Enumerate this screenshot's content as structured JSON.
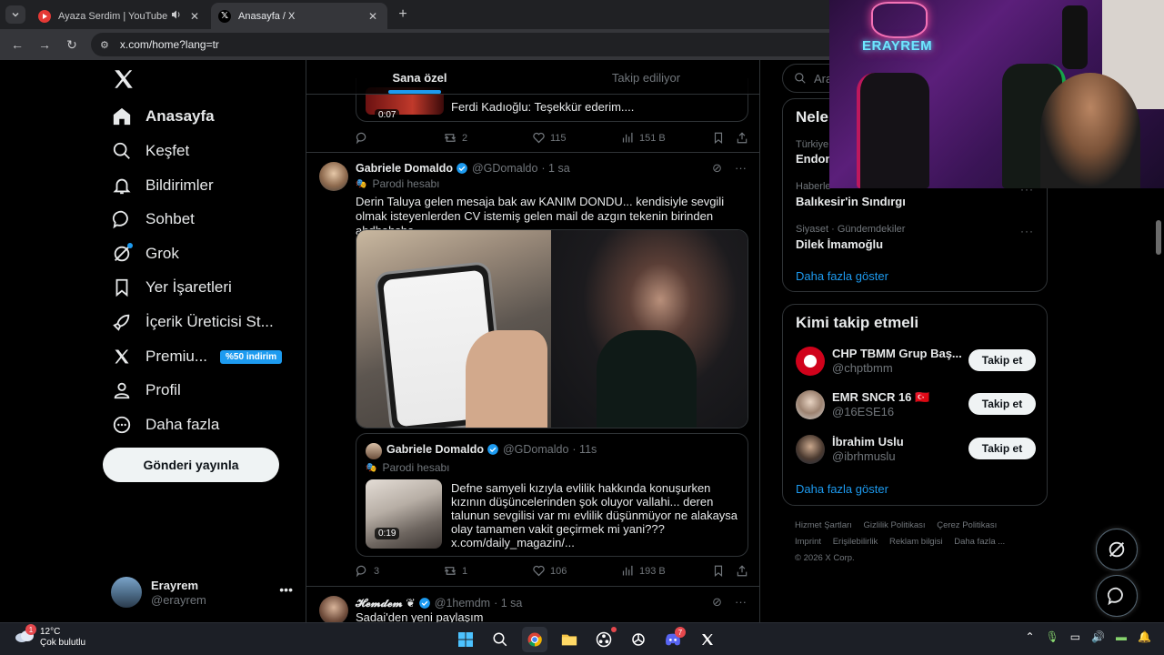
{
  "browser": {
    "tabs": [
      {
        "title": "Ayaza Serdim | YouTube Mu",
        "active": false
      },
      {
        "title": "Anasayfa / X",
        "active": true
      }
    ],
    "url": "x.com/home?lang=tr"
  },
  "webcam": {
    "logo_text": "ERAYREM"
  },
  "nav": {
    "items": [
      {
        "label": "Anasayfa",
        "icon": "home-icon"
      },
      {
        "label": "Keşfet",
        "icon": "search-icon"
      },
      {
        "label": "Bildirimler",
        "icon": "bell-icon"
      },
      {
        "label": "Sohbet",
        "icon": "chat-icon"
      },
      {
        "label": "Grok",
        "icon": "grok-icon"
      },
      {
        "label": "Yer İşaretleri",
        "icon": "bookmark-icon"
      },
      {
        "label": "İçerik Üreticisi St...",
        "icon": "rocket-icon"
      },
      {
        "label": "Premiu...",
        "icon": "x-premium-icon"
      },
      {
        "label": "Profil",
        "icon": "person-icon"
      },
      {
        "label": "Daha fazla",
        "icon": "more-circle-icon"
      }
    ],
    "premium_badge": "%50 indirim",
    "post_button": "Gönderi yayınla",
    "account": {
      "name": "Erayrem",
      "handle": "@erayrem"
    }
  },
  "feed": {
    "tabs": [
      "Sana özel",
      "Takip ediliyor"
    ],
    "prev_tweet": {
      "duration": "0:07",
      "quote_text": "Ferdi Kadıoğlu: Teşekkür ederim....",
      "stats": {
        "reply": "",
        "retweet": "2",
        "like": "115",
        "views": "151 B"
      }
    },
    "tweet": {
      "name": "Gabriele Domaldo",
      "handle": "@GDomaldo",
      "time": "· 1 sa",
      "parody": "Parodi hesabı",
      "text": "Derin Taluya gelen mesaja bak aw KANIM DONDU... kendisiyle sevgili olmak isteyenlerden CV istemiş gelen mail de azgın tekenin birinden ahdhahsha",
      "quote": {
        "name": "Gabriele Domaldo",
        "handle": "@GDomaldo",
        "time": "· 11s",
        "parody": "Parodi hesabı",
        "duration": "0:19",
        "text": "Defne samyeli kızıyla evlilik hakkında konuşurken kızının düşüncelerinden şok oluyor vallahi... deren talunun sevgilisi var mı evlilik düşünmüyor ne alakaysa olay tamamen vakit geçirmek mi yani??? x.com/daily_magazin/..."
      },
      "stats": {
        "reply": "3",
        "retweet": "1",
        "like": "106",
        "views": "193 B"
      }
    },
    "next_tweet": {
      "name": "𝓗𝓮𝓶𝓭𝓮𝓶 ❦",
      "handle": "@1hemdm",
      "time": "· 1 sa",
      "text": "Sadai'den yeni paylaşım"
    }
  },
  "sidebar": {
    "search_placeholder": "Ara",
    "trends_title": "Nele",
    "trends": [
      {
        "context": "Türkiye",
        "name": "Endon"
      },
      {
        "context": "Haberle",
        "name": "Balıkesir'in Sındırgı"
      },
      {
        "context": "Siyaset · Gündemdekiler",
        "name": "Dilek İmamoğlu"
      }
    ],
    "show_more": "Daha fazla göster",
    "who_to_follow_title": "Kimi takip etmeli",
    "suggestions": [
      {
        "name": "CHP TBMM Grup Baş...",
        "handle": "@chptbmm"
      },
      {
        "name": "EMR SNCR 16 🇹🇷",
        "handle": "@16ESE16"
      },
      {
        "name": "İbrahim Uslu",
        "handle": "@ibrhmuslu"
      }
    ],
    "follow_label": "Takip et",
    "footer": [
      "Hizmet Şartları",
      "Gizlilik Politikası",
      "Çerez Politikası",
      "Imprint",
      "Erişilebilirlik",
      "Reklam bilgisi",
      "Daha fazla ...",
      "© 2026 X Corp."
    ]
  },
  "taskbar": {
    "weather_temp": "12°C",
    "weather_desc": "Çok bulutlu",
    "weather_badge": "1",
    "discord_badge": "7"
  },
  "colors": {
    "accent": "#1d9bf0",
    "bg": "#000000",
    "border": "#2f3336",
    "muted": "#71767b"
  }
}
